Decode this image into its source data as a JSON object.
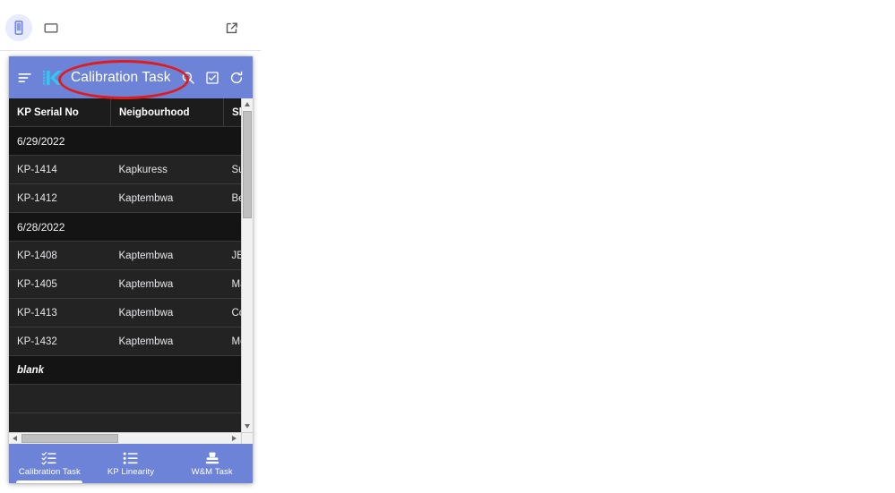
{
  "device_toolbar": {
    "mobile_view_icon": "mobile-phone-icon",
    "mobile_view_label": "Mobile view",
    "tablet_view_icon": "tablet-icon",
    "tablet_view_label": "Tablet view",
    "open_new_window_icon": "open-in-new-icon",
    "open_new_window_label": "Open in new window",
    "selected_view": "mobile"
  },
  "app": {
    "accent_color": "#6d83d8",
    "logo_color": "#31c7ee",
    "title": "Calibration Task",
    "menu_icon": "sort-menu-icon",
    "logo_icon": "k-logo-icon",
    "actions": [
      {
        "name": "search-icon",
        "label": "Search"
      },
      {
        "name": "checkbox-icon",
        "label": "Select"
      },
      {
        "name": "refresh-icon",
        "label": "Refresh"
      }
    ]
  },
  "annotation": {
    "shape": "ellipse",
    "color": "#e01b1b",
    "targets": "Calibration Task"
  },
  "table": {
    "columns": [
      "KP Serial No",
      "Neigbourhood",
      "Shop N"
    ],
    "rows": [
      {
        "type": "group",
        "label": "6/29/2022"
      },
      {
        "type": "data",
        "serial": "KP-1414",
        "neighbourhood": "Kapkuress",
        "shop": "Supane"
      },
      {
        "type": "data",
        "serial": "KP-1412",
        "neighbourhood": "Kaptembwa",
        "shop": "Benjos"
      },
      {
        "type": "group",
        "label": "6/28/2022"
      },
      {
        "type": "data",
        "serial": "KP-1408",
        "neighbourhood": "Kaptembwa",
        "shop": "JERE C"
      },
      {
        "type": "data",
        "serial": "KP-1405",
        "neighbourhood": "Kaptembwa",
        "shop": "Marhab"
      },
      {
        "type": "data",
        "serial": "KP-1413",
        "neighbourhood": "Kaptembwa",
        "shop": "Collo el"
      },
      {
        "type": "data",
        "serial": "KP-1432",
        "neighbourhood": "Kaptembwa",
        "shop": "Mosliva"
      },
      {
        "type": "blank",
        "label": "blank"
      },
      {
        "type": "empty"
      },
      {
        "type": "empty"
      }
    ]
  },
  "scrollbars": {
    "vertical_position_percent": 3,
    "horizontal_position_percent": 0
  },
  "bottom_nav": {
    "items": [
      {
        "label": "Calibration Task",
        "icon": "checklist-icon",
        "selected": true
      },
      {
        "label": "KP Linearity",
        "icon": "list-icon",
        "selected": false
      },
      {
        "label": "W&M Task",
        "icon": "stamp-icon",
        "selected": false
      }
    ]
  }
}
